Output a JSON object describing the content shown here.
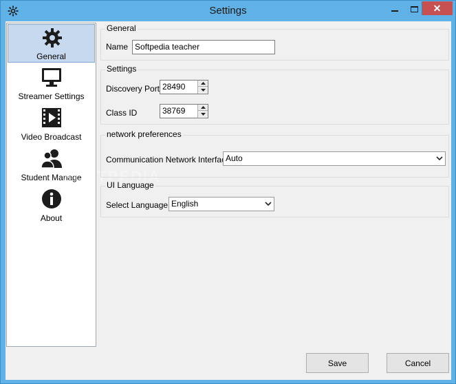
{
  "window": {
    "title": "Settings",
    "close_glyph": "✕"
  },
  "sidebar": {
    "items": [
      {
        "label": "General",
        "icon": "gear-icon",
        "active": true
      },
      {
        "label": "Streamer Settings",
        "icon": "monitor-icon",
        "active": false
      },
      {
        "label": "Video Broadcast",
        "icon": "film-icon",
        "active": false
      },
      {
        "label": "Student Manage",
        "icon": "users-icon",
        "active": false
      },
      {
        "label": "About",
        "icon": "info-icon",
        "active": false
      }
    ]
  },
  "general": {
    "title": "General",
    "name_label": "Name",
    "name_value": "Softpedia teacher"
  },
  "settings": {
    "title": "Settings",
    "discovery_port_label": "Discovery Port",
    "discovery_port_value": "28490",
    "class_id_label": "Class ID",
    "class_id_value": "38769"
  },
  "network": {
    "title": "network preferences",
    "interface_label": "Communication Network Interface",
    "interface_value": "Auto"
  },
  "ui_language": {
    "title": "UI Language",
    "select_label": "Select Language",
    "select_value": "English"
  },
  "footer": {
    "save_label": "Save",
    "cancel_label": "Cancel"
  },
  "watermark": "SOFTPEDIA",
  "colors": {
    "titlebar": "#5fb1e6",
    "close_button": "#c75050",
    "active_nav": "#c6d9ee",
    "client_bg": "#f0f0f0"
  }
}
